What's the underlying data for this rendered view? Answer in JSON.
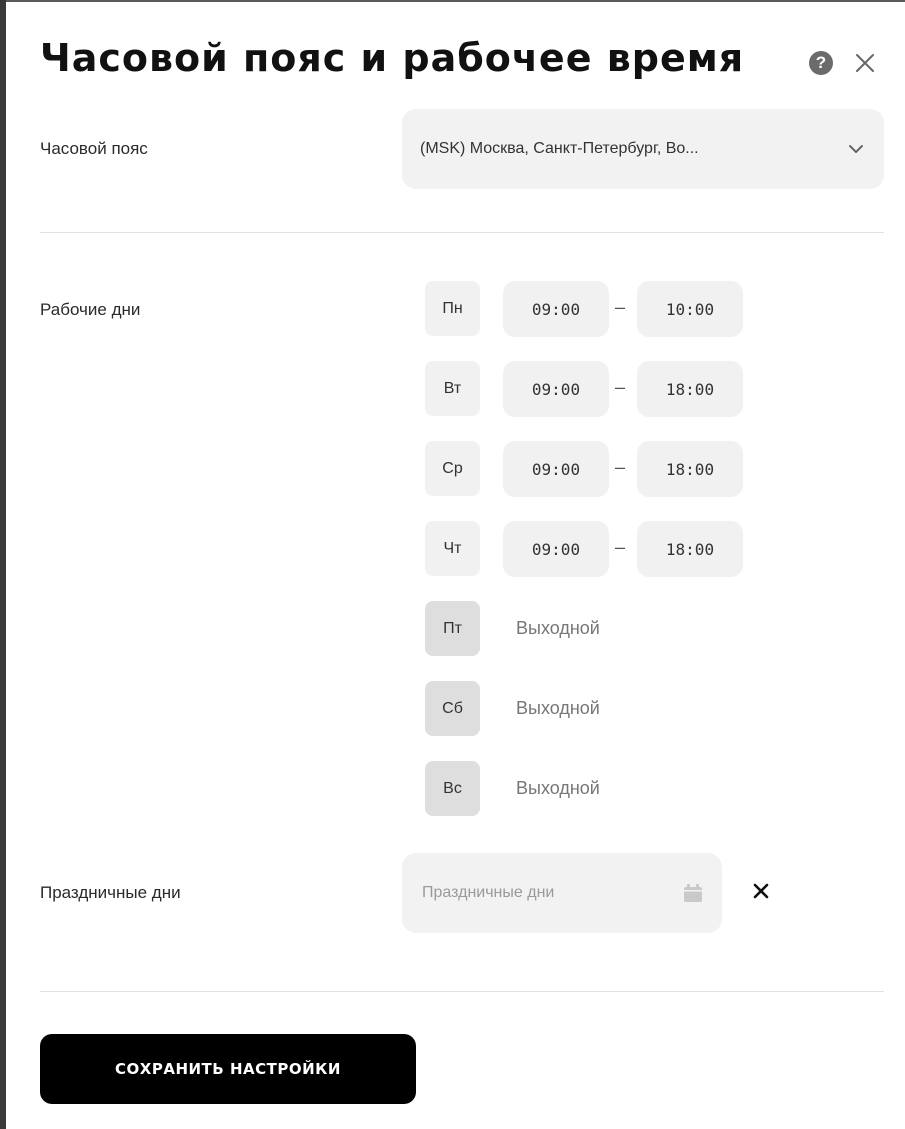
{
  "header": {
    "title": "Часовой пояс и рабочее время",
    "help_icon": "help-icon",
    "close_icon": "close-icon"
  },
  "timezone": {
    "label": "Часовой пояс",
    "value": "(MSK) Москва, Санкт-Петербург, Во...",
    "icon": "chevron-down-icon"
  },
  "workdays": {
    "label": "Рабочие дни",
    "separator": "–",
    "days": [
      {
        "day": "Пн",
        "start": "09:00",
        "end": "10:00"
      },
      {
        "day": "Вт",
        "start": "09:00",
        "end": "18:00"
      },
      {
        "day": "Ср",
        "start": "09:00",
        "end": "18:00"
      },
      {
        "day": "Чт",
        "start": "09:00",
        "end": "18:00"
      },
      {
        "day": "Пт",
        "status": "Выходной"
      },
      {
        "day": "Сб",
        "status": "Выходной"
      },
      {
        "day": "Вс",
        "status": "Выходной"
      }
    ]
  },
  "holidays": {
    "label": "Праздничные дни",
    "placeholder": "Праздничные дни",
    "calendar_icon": "calendar-icon",
    "clear_icon": "clear-icon"
  },
  "actions": {
    "save_label": "СОХРАНИТЬ НАСТРОЙКИ"
  },
  "colors": {
    "primary_button": "#000000",
    "field_background": "#f2f2f2",
    "day_off_badge": "#dedede"
  }
}
